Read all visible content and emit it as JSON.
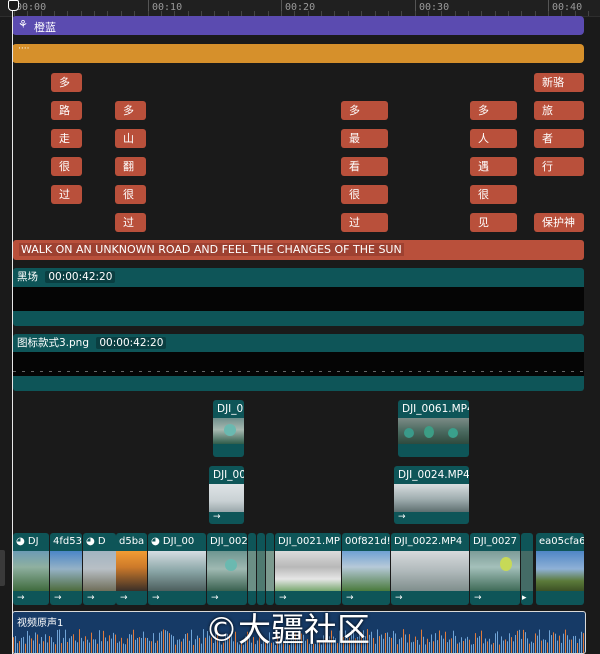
{
  "ruler": {
    "labels": [
      "00:00",
      "00:10",
      "00:20",
      "00:30",
      "00:40"
    ]
  },
  "tracks": {
    "filter": {
      "label": "橙蓝",
      "icon": "filter-circles-icon",
      "color": "#5b4bb0"
    },
    "effect": {
      "label": "····",
      "color": "#d6902b"
    },
    "text_clips": {
      "col1": [
        "多",
        "路",
        "走",
        "很",
        "过"
      ],
      "col2": [
        "多",
        "山",
        "翻",
        "很",
        "过"
      ],
      "col3": [
        "多",
        "最",
        "看",
        "很",
        "过"
      ],
      "col4": [
        "多",
        "人",
        "遇",
        "很",
        "见"
      ],
      "col5": [
        "新骆",
        "旅",
        "者",
        "行",
        "保护神"
      ]
    },
    "subtitle": "WALK ON AN UNKNOWN ROAD AND FEEL THE CHANGES OF THE SUN",
    "black_clip": {
      "name": "黑场",
      "duration": "00:00:42:20"
    },
    "image_clip": {
      "name": "图标款式3.png",
      "duration": "00:00:42:20"
    },
    "overlay1": [
      {
        "name": "DJI_0"
      },
      {
        "name": "DJI_0061.MP4"
      }
    ],
    "overlay2": [
      {
        "name": "DJI_00"
      },
      {
        "name": "DJI_0024.MP4"
      }
    ],
    "main_clips": [
      "DJ",
      "4fd53",
      "D",
      "d5ba",
      "DJI_00",
      "DJI_002",
      "DJI_0021.MP",
      "00f821d!",
      "DJI_0022.MP4",
      "DJI_0027",
      "ea05cfa6"
    ],
    "audio": {
      "name": "视频原声1"
    }
  },
  "watermark": "©大疆社区",
  "colors": {
    "text_clip": "#b9503b",
    "video": "#0e5558",
    "audio": "#163a66"
  }
}
